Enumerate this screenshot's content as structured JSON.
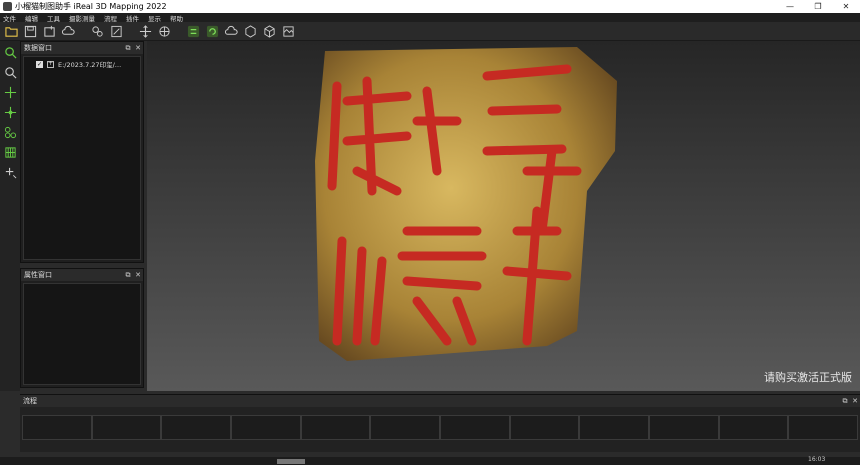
{
  "window": {
    "title": "小榴猫制图助手 iReal 3D Mapping 2022",
    "controls": [
      "—",
      "❐",
      "✕"
    ]
  },
  "menu": [
    "文件",
    "编辑",
    "工具",
    "摄影测量",
    "流程",
    "插件",
    "显示",
    "帮助"
  ],
  "toolbar": {
    "icons": [
      "folder-open-icon",
      "save-icon",
      "new-project-icon",
      "cloud-icon",
      "process-icon",
      "script-icon",
      "move-icon",
      "rotate-icon",
      "sync-icon",
      "refresh-icon",
      "cloud-upload-icon",
      "cube-icon",
      "cube-alt-icon",
      "texture-icon"
    ]
  },
  "side_tools": [
    "search-icon",
    "zoom-icon",
    "crosshair-icon",
    "point-pick-icon",
    "node-icon",
    "grid-icon",
    "add-point-icon"
  ],
  "data_panel": {
    "title": "数据窗口",
    "tree": [
      {
        "checked": true,
        "label": "E:/2023.7.27印玺/…"
      }
    ]
  },
  "property_panel": {
    "title": "属性窗口"
  },
  "process_panel": {
    "title": "流程"
  },
  "viewport": {
    "watermark": "请购买激活正式版"
  },
  "status": {
    "time": "16:03"
  },
  "colors": {
    "seal_body": "#b89444",
    "seal_carving": "#c62a22",
    "accent_green": "#66cc44"
  }
}
